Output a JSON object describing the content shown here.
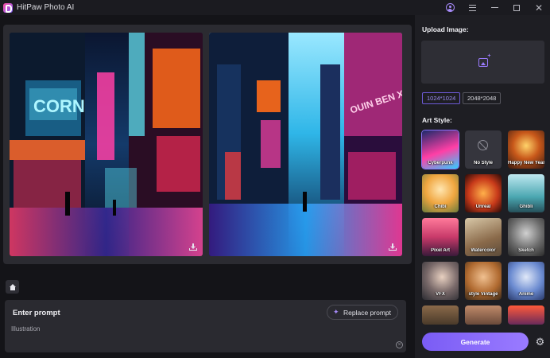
{
  "app": {
    "title": "HitPaw Photo AI"
  },
  "window_controls": {
    "user": "user-icon",
    "menu": "menu-icon",
    "minimize": "minimize-icon",
    "maximize": "maximize-icon",
    "close": "close-icon"
  },
  "gallery": {
    "images": [
      {
        "name": "result-image-1",
        "scene": "neon cyberpunk street with CORN sign"
      },
      {
        "name": "result-image-2",
        "scene": "neon cyberpunk alley with blue glow"
      }
    ]
  },
  "prompt": {
    "title": "Enter prompt",
    "text": "Illustration",
    "replace_label": "Replace prompt"
  },
  "panel": {
    "upload_heading": "Upload Image:",
    "sizes": [
      "1024*1024",
      "2048*2048"
    ],
    "selected_size": "1024*1024",
    "art_style_heading": "Art Style:",
    "styles": [
      {
        "label": "Cyberpunk",
        "selected": true
      },
      {
        "label": "No Style",
        "selected": false
      },
      {
        "label": "Happy New Year",
        "selected": false
      },
      {
        "label": "Chibi",
        "selected": false
      },
      {
        "label": "Unreal",
        "selected": false
      },
      {
        "label": "Ghibli",
        "selected": false
      },
      {
        "label": "Pixel Art",
        "selected": false
      },
      {
        "label": "Watercolor",
        "selected": false
      },
      {
        "label": "Sketch",
        "selected": false
      },
      {
        "label": "VFX",
        "selected": false
      },
      {
        "label": "style Vintage",
        "selected": false
      },
      {
        "label": "Anime",
        "selected": false
      },
      {
        "label": "",
        "selected": false
      },
      {
        "label": "",
        "selected": false
      },
      {
        "label": "",
        "selected": false
      }
    ],
    "generate_label": "Generate"
  },
  "colors": {
    "accent": "#8b73ff",
    "panel_bg": "#1e1e23",
    "app_bg": "#141418"
  }
}
